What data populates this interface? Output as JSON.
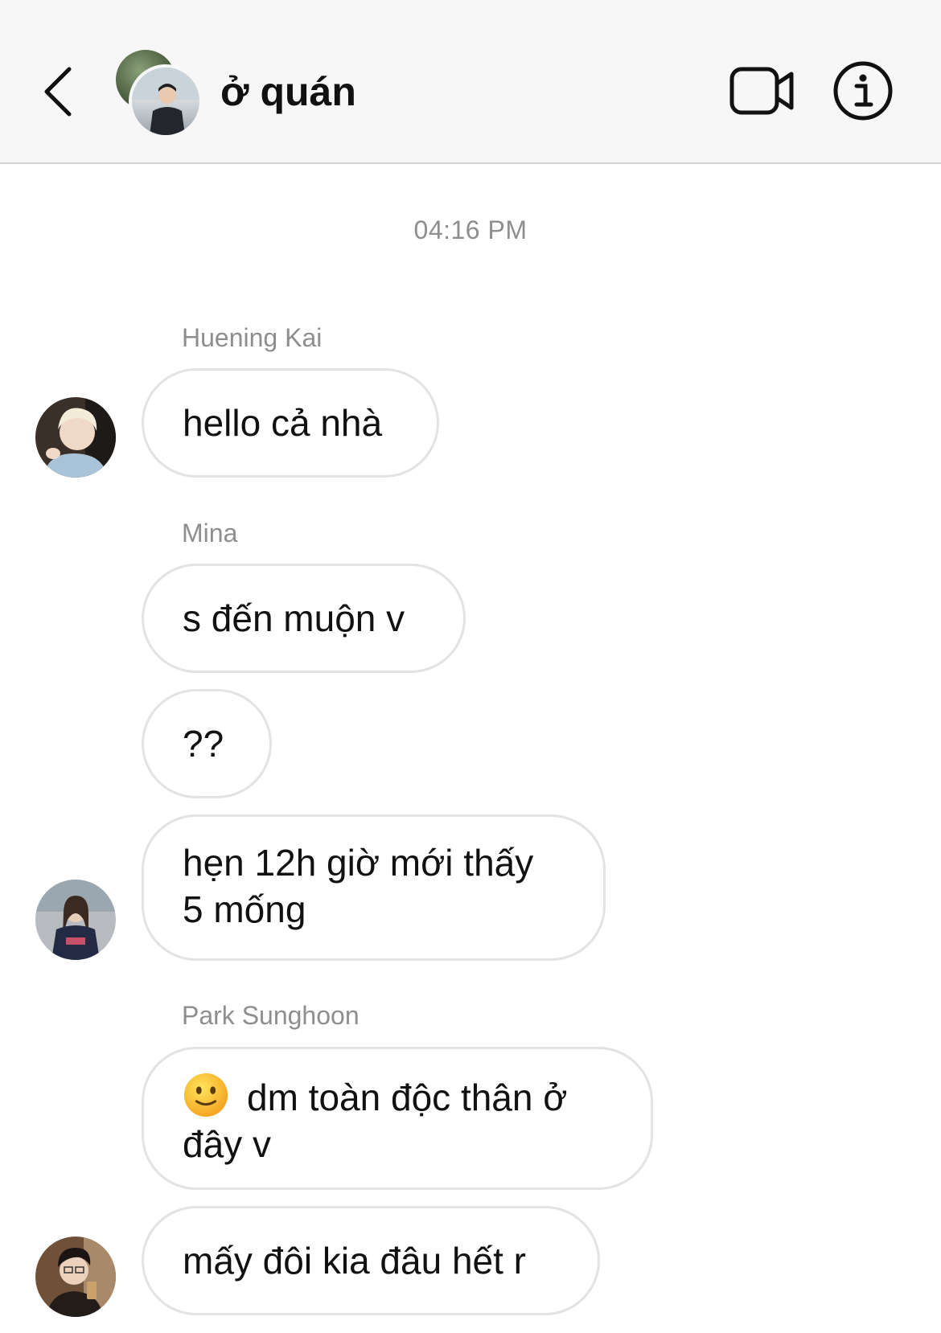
{
  "header": {
    "title": "ở quán",
    "back_icon": "chevron-left-icon",
    "video_icon": "video-camera-icon",
    "info_icon": "info-icon"
  },
  "chat": {
    "timestamp": "04:16 PM",
    "messages": [
      {
        "sender": "Huening Kai",
        "text": "hello cả nhà"
      },
      {
        "sender": "Mina",
        "text": "s đến muộn v"
      },
      {
        "sender": "",
        "text": "??"
      },
      {
        "sender": "",
        "lines": [
          "hẹn 12h giờ mới thấy",
          "5 mống"
        ]
      },
      {
        "sender": "Park Sunghoon",
        "emoji": "slightly-smiling-face-icon",
        "lines": [
          "dm toàn độc thân ở",
          "đây v"
        ]
      },
      {
        "sender": "",
        "text": "mấy đôi kia đâu hết r"
      }
    ]
  },
  "colors": {
    "header_bg": "#f7f7f7",
    "bubble_border": "#e3e3e3",
    "meta_text": "#8e8e8e",
    "text": "#111111"
  }
}
